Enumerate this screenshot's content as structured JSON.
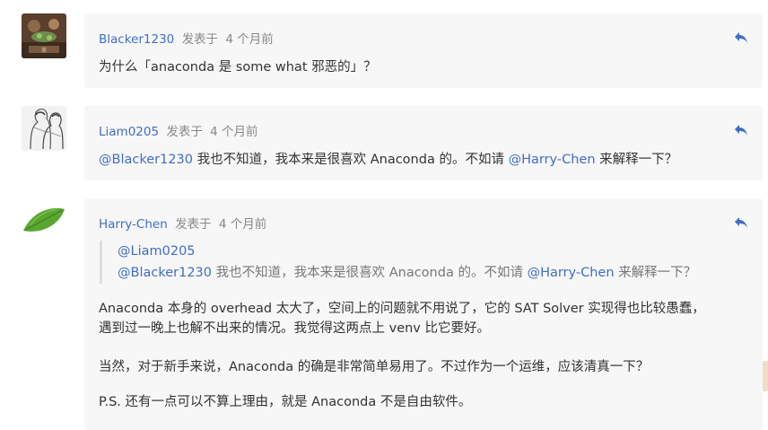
{
  "accent": "#3f6ec4",
  "comments": [
    {
      "username": "Blacker1230",
      "posted_label": "发表于",
      "time_ago": "4 个月前",
      "avatar_icon": "tea-table-photo-avatar",
      "text": "为什么「anaconda 是 some what 邪恶的」？"
    },
    {
      "username": "Liam0205",
      "posted_label": "发表于",
      "time_ago": "4 个月前",
      "avatar_icon": "sketch-couple-avatar",
      "mention1": "@Blacker1230",
      "text1": " 我也不知道，我本来是很喜欢 Anaconda 的。不如请 ",
      "mention2": "@Harry-Chen",
      "text2": " 来解释一下？"
    },
    {
      "username": "Harry-Chen",
      "posted_label": "发表于",
      "time_ago": "4 个月前",
      "avatar_icon": "green-leaf-avatar",
      "quote": {
        "line1_mention": "@Liam0205",
        "line2_mention1": "@Blacker1230",
        "line2_text1": " 我也不知道，我本来是很喜欢 Anaconda 的。不如请 ",
        "line2_mention2": "@Harry-Chen",
        "line2_text2": " 来解释一下？"
      },
      "para1_line1": "Anaconda 本身的 overhead 太大了，空间上的问题就不用说了，它的 SAT Solver 实现得也比较愚蠢，",
      "para1_line2": "遇到过一晚上也解不出来的情况。我觉得这两点上 venv 比它要好。",
      "para2": "当然，对于新手来说，Anaconda 的确是非常简单易用了。不过作为一个运维，应该清真一下？",
      "para3": "P.S. 还有一点可以不算上理由，就是 Anaconda 不是自由软件。"
    }
  ]
}
